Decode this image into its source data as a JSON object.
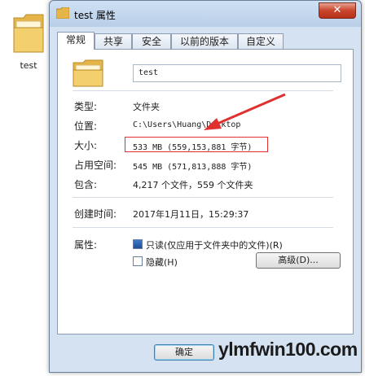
{
  "desktop": {
    "icon_label": "test"
  },
  "window": {
    "title": "test 属性",
    "close_symbol": "✕"
  },
  "tabs": [
    {
      "label": "常规",
      "active": true
    },
    {
      "label": "共享",
      "active": false
    },
    {
      "label": "安全",
      "active": false
    },
    {
      "label": "以前的版本",
      "active": false
    },
    {
      "label": "自定义",
      "active": false
    }
  ],
  "general": {
    "name": "test",
    "type_label": "类型:",
    "type_value": "文件夹",
    "location_label": "位置:",
    "location_value": "C:\\Users\\Huang\\Desktop",
    "size_label": "大小:",
    "size_value": "533 MB (559,153,881 字节)",
    "disk_size_label": "占用空间:",
    "disk_size_value": "545 MB (571,813,888 字节)",
    "contains_label": "包含:",
    "contains_value": "4,217 个文件，559 个文件夹",
    "created_label": "创建时间:",
    "created_value": "2017年1月11日，15:29:37",
    "attributes_label": "属性:",
    "readonly_label": "只读(仅应用于文件夹中的文件)(R)",
    "readonly_checked": true,
    "hidden_label": "隐藏(H)",
    "hidden_checked": false,
    "advanced_button": "高级(D)..."
  },
  "footer": {
    "ok_button": "确定"
  },
  "watermark": "ylmfwin100.com",
  "colors": {
    "highlight_box": "#e03030",
    "arrow": "#e03030"
  }
}
